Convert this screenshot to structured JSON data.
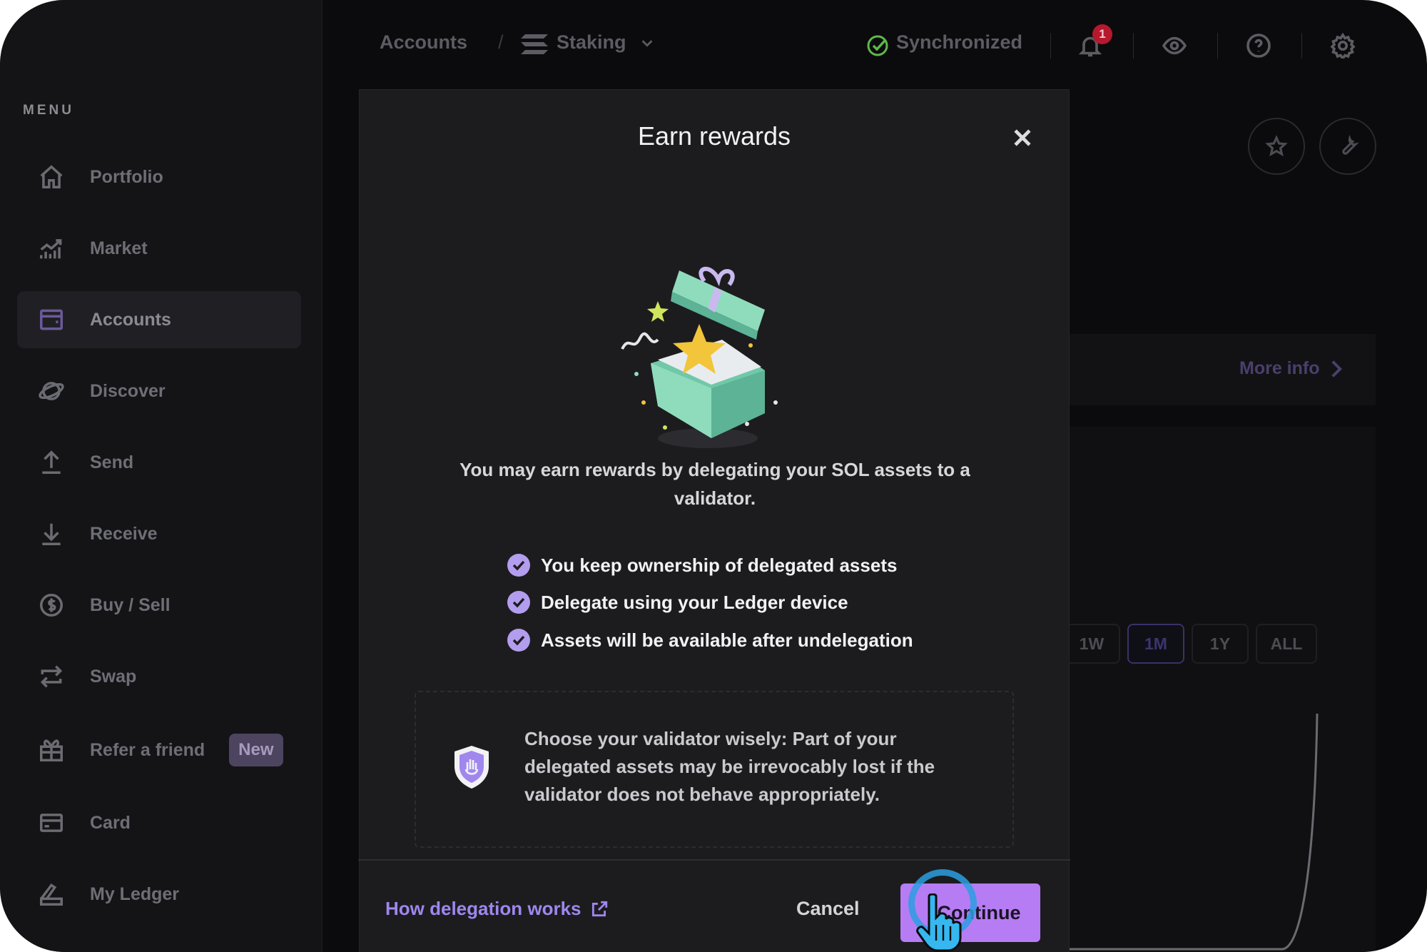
{
  "sidebar": {
    "menu_title": "MENU",
    "items": [
      {
        "label": "Portfolio",
        "icon": "home-icon"
      },
      {
        "label": "Market",
        "icon": "market-chart-icon"
      },
      {
        "label": "Accounts",
        "icon": "wallet-icon",
        "active": true
      },
      {
        "label": "Discover",
        "icon": "planet-icon"
      },
      {
        "label": "Send",
        "icon": "arrow-up-icon"
      },
      {
        "label": "Receive",
        "icon": "arrow-down-icon"
      },
      {
        "label": "Buy / Sell",
        "icon": "dollar-icon"
      },
      {
        "label": "Swap",
        "icon": "swap-icon"
      },
      {
        "label": "Refer a friend",
        "icon": "gift-icon",
        "badge": "New"
      },
      {
        "label": "Card",
        "icon": "card-icon"
      },
      {
        "label": "My Ledger",
        "icon": "ledger-icon"
      }
    ]
  },
  "topbar": {
    "breadcrumb_accounts": "Accounts",
    "breadcrumb_separator": "/",
    "breadcrumb_staking": "Staking",
    "sync_status": "Synchronized",
    "notification_count": "1"
  },
  "background": {
    "more_info": "More info",
    "ranges": [
      "1W",
      "1M",
      "1Y",
      "ALL"
    ],
    "active_range": "1M"
  },
  "modal": {
    "title": "Earn rewards",
    "intro": "You may earn rewards by delegating your SOL assets to a validator.",
    "bullets": [
      "You keep ownership of delegated assets",
      "Delegate using your Ledger device",
      "Assets will be available after undelegation"
    ],
    "warning": "Choose your validator wisely: Part of your delegated assets may be irrevocably lost if the validator does not behave appropriately.",
    "link": "How delegation works",
    "cancel": "Cancel",
    "continue": "Continue"
  },
  "colors": {
    "accent": "#b67cf3",
    "link": "#9f87ee",
    "sync_green": "#5fb84a",
    "badge_red": "#b6182e"
  }
}
